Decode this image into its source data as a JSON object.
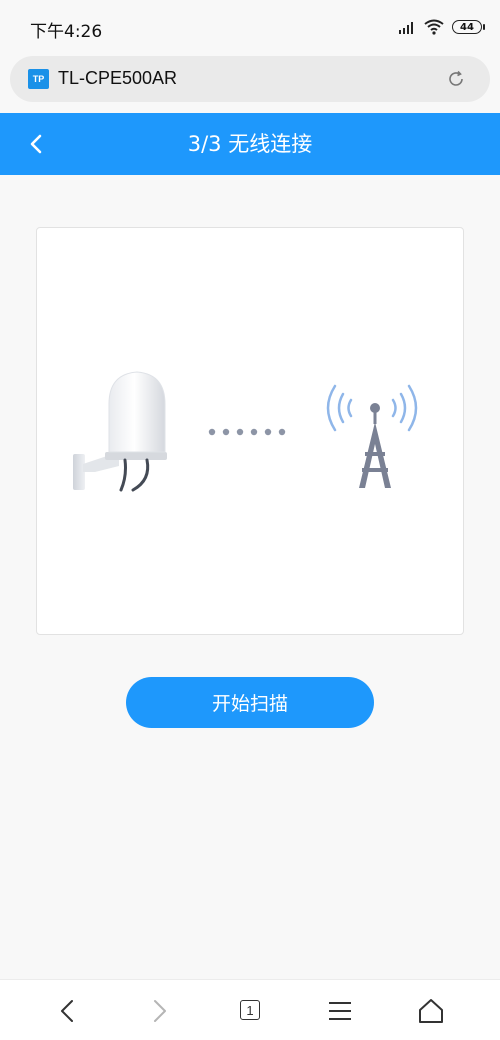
{
  "status_bar": {
    "time": "下午4:26",
    "battery": "44"
  },
  "browser": {
    "logo_text": "TP",
    "url": "TL-CPE500AR",
    "tab_count": "1"
  },
  "header": {
    "title": "3/3 无线连接"
  },
  "main": {
    "scan_button_label": "开始扫描"
  },
  "colors": {
    "accent": "#1e98fc",
    "background": "#f8f8f8"
  }
}
